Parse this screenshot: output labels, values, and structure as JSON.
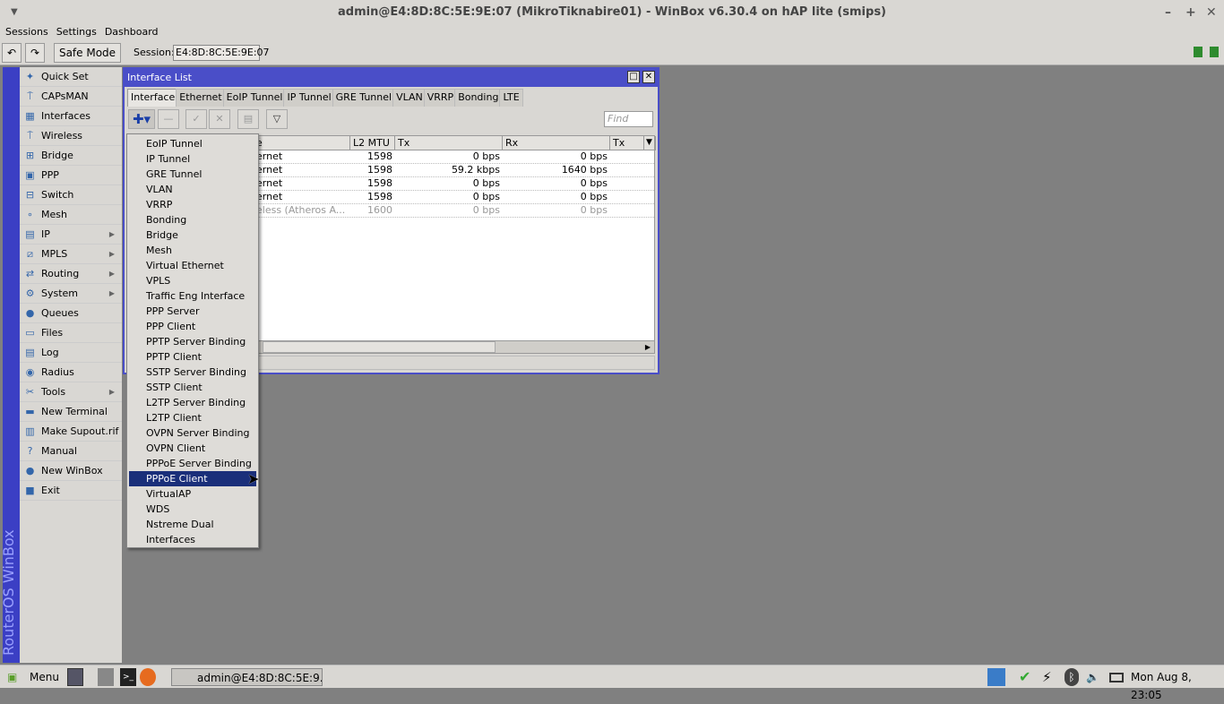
{
  "window": {
    "title": "admin@E4:8D:8C:5E:9E:07 (MikroTiknabire01) - WinBox v6.30.4 on hAP lite (smips)",
    "minimize": "–",
    "maximize": "+",
    "close": "✕"
  },
  "menu": [
    "Sessions",
    "Settings",
    "Dashboard"
  ],
  "toolbar": {
    "undo": "↶",
    "redo": "↷",
    "safe_mode": "Safe Mode",
    "session_label": "Session:",
    "session_value": "E4:8D:8C:5E:9E:07"
  },
  "brand_strip": "RouterOS WinBox",
  "sidebar": [
    {
      "label": "Quick Set",
      "icon": "wand-icon",
      "sub": false
    },
    {
      "label": "CAPsMAN",
      "icon": "antenna-icon",
      "sub": false
    },
    {
      "label": "Interfaces",
      "icon": "interfaces-icon",
      "sub": false
    },
    {
      "label": "Wireless",
      "icon": "antenna-icon",
      "sub": false
    },
    {
      "label": "Bridge",
      "icon": "bridge-icon",
      "sub": false
    },
    {
      "label": "PPP",
      "icon": "ppp-icon",
      "sub": false
    },
    {
      "label": "Switch",
      "icon": "switch-icon",
      "sub": false
    },
    {
      "label": "Mesh",
      "icon": "mesh-icon",
      "sub": false
    },
    {
      "label": "IP",
      "icon": "ip-icon",
      "sub": true
    },
    {
      "label": "MPLS",
      "icon": "mpls-icon",
      "sub": true
    },
    {
      "label": "Routing",
      "icon": "routing-icon",
      "sub": true
    },
    {
      "label": "System",
      "icon": "gear-icon",
      "sub": true
    },
    {
      "label": "Queues",
      "icon": "queues-icon",
      "sub": false
    },
    {
      "label": "Files",
      "icon": "folder-icon",
      "sub": false
    },
    {
      "label": "Log",
      "icon": "log-icon",
      "sub": false
    },
    {
      "label": "Radius",
      "icon": "radius-icon",
      "sub": false
    },
    {
      "label": "Tools",
      "icon": "tools-icon",
      "sub": true
    },
    {
      "label": "New Terminal",
      "icon": "terminal-icon",
      "sub": false
    },
    {
      "label": "Make Supout.rif",
      "icon": "supout-icon",
      "sub": false
    },
    {
      "label": "Manual",
      "icon": "help-icon",
      "sub": false
    },
    {
      "label": "New WinBox",
      "icon": "winbox-icon",
      "sub": false
    },
    {
      "label": "Exit",
      "icon": "exit-icon",
      "sub": false
    }
  ],
  "interface_list": {
    "title": "Interface List",
    "tabs": [
      "Interface",
      "Ethernet",
      "EoIP Tunnel",
      "IP Tunnel",
      "GRE Tunnel",
      "VLAN",
      "VRRP",
      "Bonding",
      "LTE"
    ],
    "active_tab": "Interface",
    "find_placeholder": "Find",
    "columns": [
      "e",
      "L2 MTU",
      "Tx",
      "Rx",
      "Tx Pac"
    ],
    "rows": [
      {
        "type": "ernet",
        "mtu": "1598",
        "tx": "0 bps",
        "rx": "0 bps",
        "disabled": false
      },
      {
        "type": "ernet",
        "mtu": "1598",
        "tx": "59.2 kbps",
        "rx": "1640 bps",
        "disabled": false
      },
      {
        "type": "ernet",
        "mtu": "1598",
        "tx": "0 bps",
        "rx": "0 bps",
        "disabled": false
      },
      {
        "type": "ernet",
        "mtu": "1598",
        "tx": "0 bps",
        "rx": "0 bps",
        "disabled": false
      },
      {
        "type": "eless (Atheros A...",
        "mtu": "1600",
        "tx": "0 bps",
        "rx": "0 bps",
        "disabled": true
      }
    ]
  },
  "add_menu": {
    "items": [
      "EoIP Tunnel",
      "IP Tunnel",
      "GRE Tunnel",
      "VLAN",
      "VRRP",
      "Bonding",
      "Bridge",
      "Mesh",
      "Virtual Ethernet",
      "VPLS",
      "Traffic Eng Interface",
      "PPP Server",
      "PPP Client",
      "PPTP Server Binding",
      "PPTP Client",
      "SSTP Server Binding",
      "SSTP Client",
      "L2TP Server Binding",
      "L2TP Client",
      "OVPN Server Binding",
      "OVPN Client",
      "PPPoE Server Binding",
      "PPPoE Client",
      "VirtualAP",
      "WDS",
      "Nstreme Dual",
      "Interfaces"
    ],
    "selected": "PPPoE Client"
  },
  "taskbar": {
    "menu": "Menu",
    "task": "admin@E4:8D:8C:5E:9...",
    "clock": "Mon Aug  8, 23:05"
  }
}
